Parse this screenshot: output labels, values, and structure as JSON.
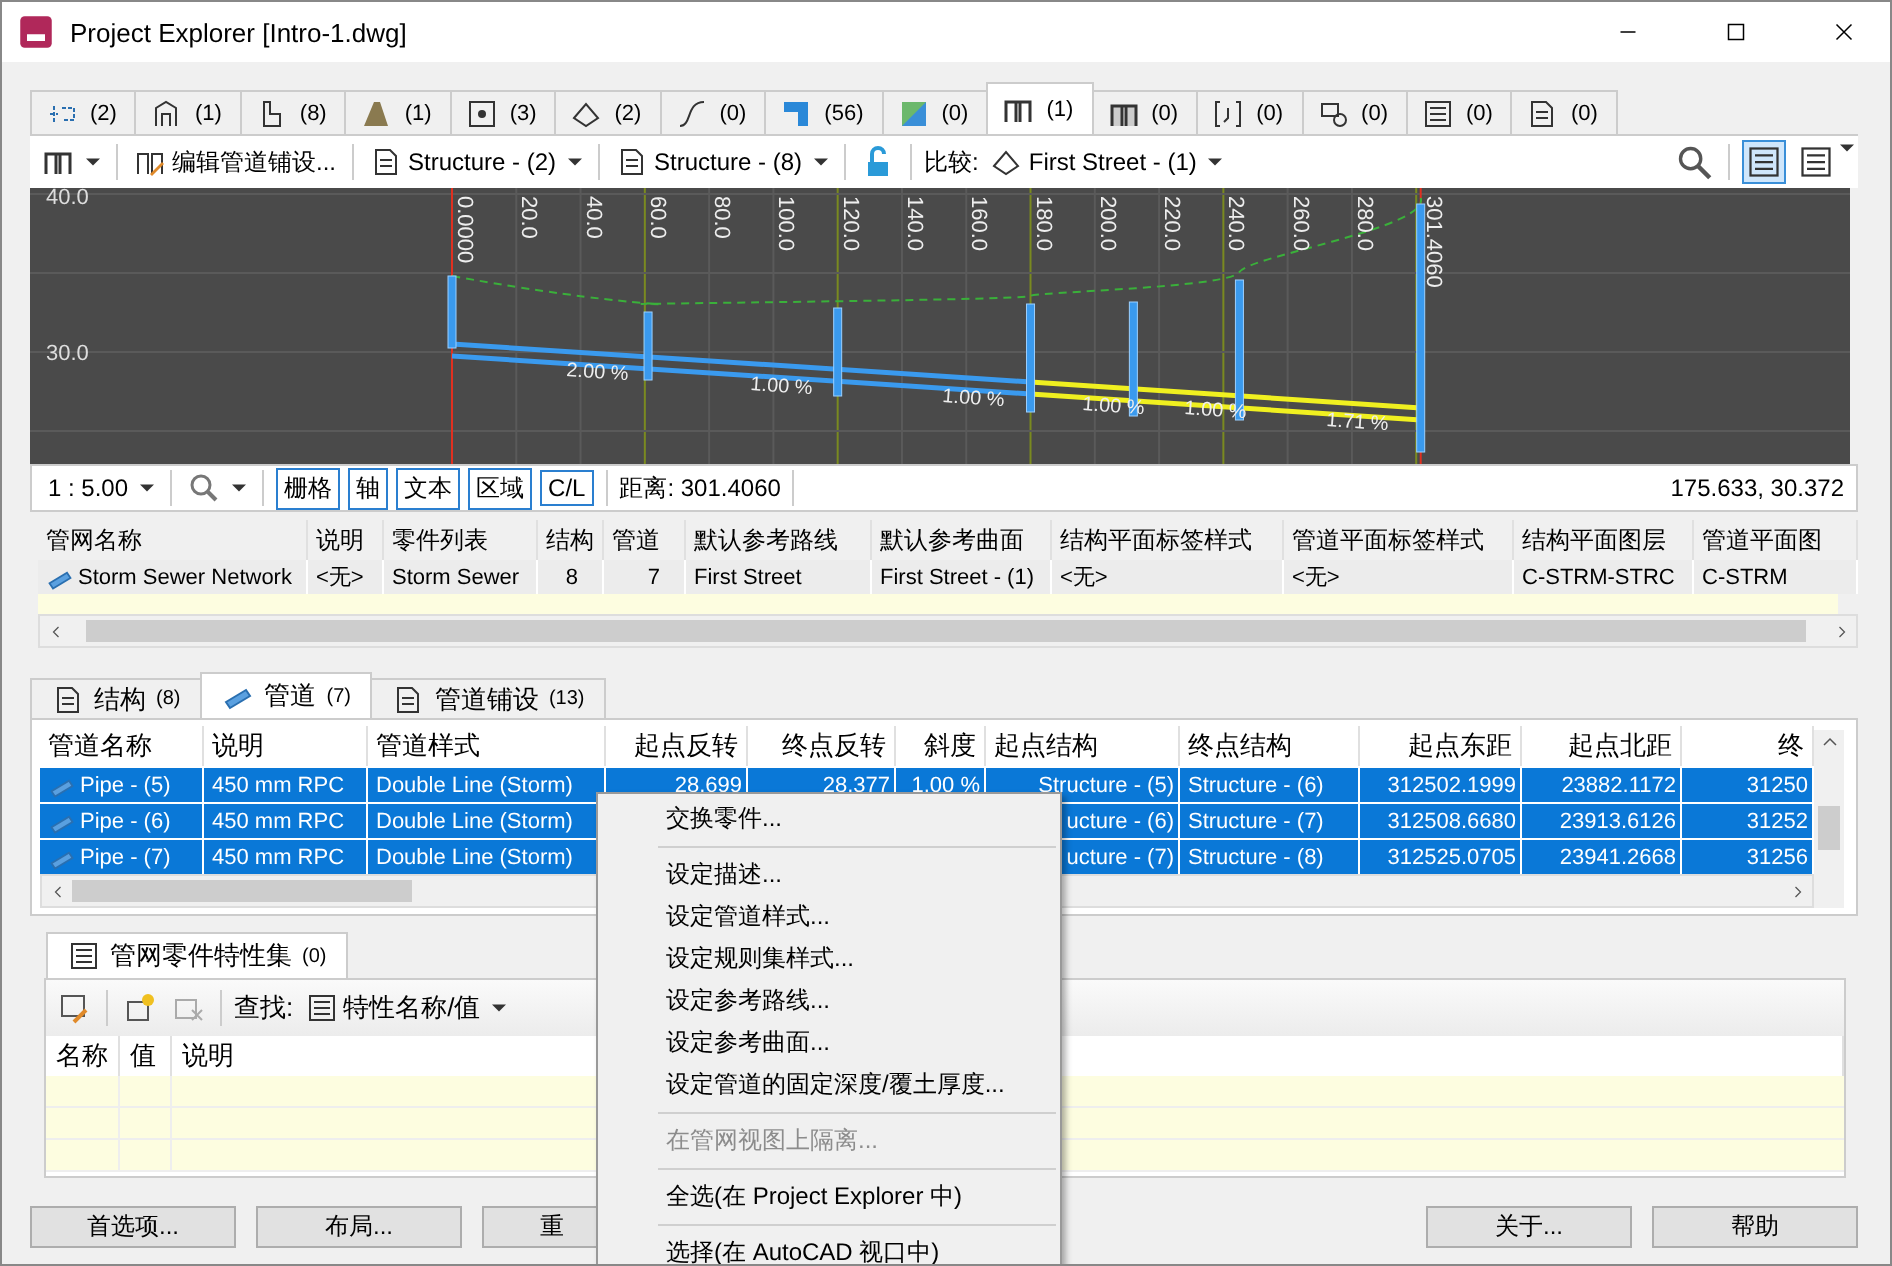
{
  "window": {
    "title": "Project Explorer [Intro-1.dwg]"
  },
  "object_tabs": [
    {
      "count": "(2)",
      "selected": false
    },
    {
      "count": "(1)",
      "selected": false
    },
    {
      "count": "(8)",
      "selected": false
    },
    {
      "count": "(1)",
      "selected": false
    },
    {
      "count": "(3)",
      "selected": false
    },
    {
      "count": "(2)",
      "selected": false
    },
    {
      "count": "(0)",
      "selected": false
    },
    {
      "count": "(56)",
      "selected": false
    },
    {
      "count": "(0)",
      "selected": false
    },
    {
      "count": "(1)",
      "selected": true
    },
    {
      "count": "(0)",
      "selected": false
    },
    {
      "count": "(0)",
      "selected": false
    },
    {
      "count": "(0)",
      "selected": false
    },
    {
      "count": "(0)",
      "selected": false
    },
    {
      "count": "(0)",
      "selected": false
    }
  ],
  "toolbar": {
    "edit_label": "编辑管道铺设...",
    "start_structure": "Structure - (2)",
    "end_structure": "Structure - (8)",
    "compare_label": "比较:",
    "compare_value": "First Street - (1)",
    "views": [
      {
        "selected": true
      },
      {
        "selected": false
      }
    ]
  },
  "profile": {
    "elevation_labels": [
      "40.0",
      "30.0"
    ],
    "station_labels": [
      "0.0000",
      "20.0",
      "40.0",
      "60.0",
      "80.0",
      "100.0",
      "120.0",
      "140.0",
      "160.0",
      "180.0",
      "200.0",
      "220.0",
      "240.0",
      "260.0",
      "280.0",
      "301.4060"
    ],
    "slope_labels": [
      "2.00 %",
      "1.00 %",
      "1.00 %",
      "1.00 %",
      "1.00 %",
      "1.71 %"
    ]
  },
  "profile_status": {
    "scale": "1 : 5.00",
    "toggles": [
      {
        "label": "栅格",
        "on": true
      },
      {
        "label": "轴",
        "on": true
      },
      {
        "label": "文本",
        "on": true
      },
      {
        "label": "区域",
        "on": true
      },
      {
        "label": "C/L",
        "on": true
      }
    ],
    "distance": "距离: 301.4060",
    "coordinates": "175.633, 30.372"
  },
  "network_table": {
    "columns": [
      "管网名称",
      "说明",
      "零件列表",
      "结构",
      "管道",
      "默认参考路线",
      "默认参考曲面",
      "结构平面标签样式",
      "管道平面标签样式",
      "结构平面图层",
      "管道平面图"
    ],
    "rows": [
      {
        "cells": [
          "Storm Sewer Network",
          "<无>",
          "Storm Sewer",
          "8",
          "7",
          "First Street",
          "First Street - (1)",
          "<无>",
          "<无>",
          "C-STRM-STRC",
          "C-STRM"
        ]
      }
    ]
  },
  "part_tabs": [
    {
      "label": "结构",
      "count": "(8)",
      "selected": false
    },
    {
      "label": "管道",
      "count": "(7)",
      "selected": true
    },
    {
      "label": "管道铺设",
      "count": "(13)",
      "selected": false
    }
  ],
  "pipe_table": {
    "columns": [
      "管道名称",
      "说明",
      "管道样式",
      "起点反转",
      "终点反转",
      "斜度",
      "起点结构",
      "终点结构",
      "起点东距",
      "起点北距",
      "终"
    ],
    "rows": [
      {
        "selected": true,
        "name": "Pipe - (5)",
        "description": "450 mm RPC",
        "style": "Double Line (Storm)",
        "start_invert": "28.699",
        "end_invert": "28.377",
        "slope": "1.00 %",
        "start_structure": "Structure - (5)",
        "end_structure": "Structure - (6)",
        "start_easting": "312502.1999",
        "start_northing": "23882.1172",
        "column_11": "31250"
      },
      {
        "selected": true,
        "name": "Pipe - (6)",
        "description": "450 mm RPC",
        "style": "Double Line (Storm)",
        "start_structure": "ucture - (6)",
        "end_structure": "Structure - (7)",
        "start_easting": "312508.6680",
        "start_northing": "23913.6126",
        "column_11": "31252"
      },
      {
        "selected": true,
        "name": "Pipe - (7)",
        "description": "450 mm RPC",
        "style": "Double Line (Storm)",
        "start_structure": "ucture - (7)",
        "end_structure": "Structure - (8)",
        "start_easting": "312525.0705",
        "start_northing": "23941.2668",
        "column_11": "31256"
      }
    ]
  },
  "property_panel": {
    "tab": "管网零件特性集",
    "count": "(0)",
    "find_label": "查找:",
    "find_value": "特性名称/值",
    "columns": [
      "名称",
      "值",
      "说明"
    ]
  },
  "buttons": [
    "首选项...",
    "布局...",
    "重",
    "关于...",
    "帮助"
  ],
  "context_menu": [
    {
      "kind": "item",
      "label": "交换零件...",
      "disabled": false
    },
    {
      "kind": "separator"
    },
    {
      "kind": "item",
      "label": "设定描述...",
      "disabled": false
    },
    {
      "kind": "item",
      "label": "设定管道样式...",
      "disabled": false
    },
    {
      "kind": "item",
      "label": "设定规则集样式...",
      "disabled": false
    },
    {
      "kind": "item",
      "label": "设定参考路线...",
      "disabled": false
    },
    {
      "kind": "item",
      "label": "设定参考曲面...",
      "disabled": false
    },
    {
      "kind": "item",
      "label": "设定管道的固定深度/覆土厚度...",
      "disabled": false
    },
    {
      "kind": "separator"
    },
    {
      "kind": "item",
      "label": "在管网视图上隔离...",
      "disabled": true
    },
    {
      "kind": "separator"
    },
    {
      "kind": "item",
      "label": "全选(在 Project Explorer 中)",
      "disabled": false
    },
    {
      "kind": "separator"
    },
    {
      "kind": "item",
      "label": "选择(在 AutoCAD 视口中)",
      "disabled": false
    }
  ]
}
